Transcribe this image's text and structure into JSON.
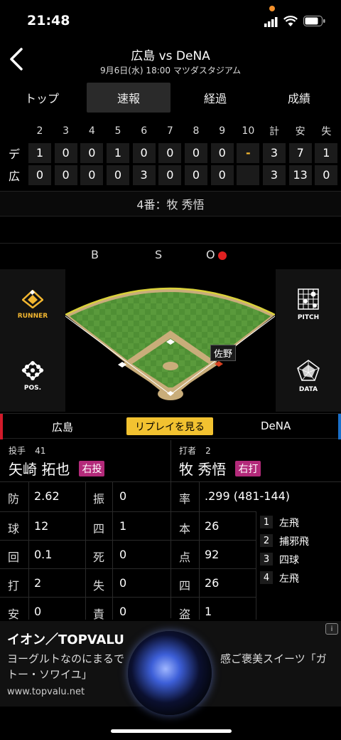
{
  "status": {
    "time": "21:48"
  },
  "header": {
    "title": "広島 vs DeNA",
    "subtitle": "9月6日(水) 18:00 マツダスタジアム"
  },
  "tabs": [
    "トップ",
    "速報",
    "経過",
    "成績"
  ],
  "active_tab": "速報",
  "scoreboard": {
    "headers": [
      "2",
      "3",
      "4",
      "5",
      "6",
      "7",
      "8",
      "9",
      "10",
      "計",
      "安",
      "失"
    ],
    "rows": [
      {
        "team": "デ",
        "cells": [
          "1",
          "0",
          "0",
          "1",
          "0",
          "0",
          "0",
          "0",
          "-",
          "3",
          "7",
          "1"
        ]
      },
      {
        "team": "広",
        "cells": [
          "0",
          "0",
          "0",
          "0",
          "3",
          "0",
          "0",
          "0",
          "",
          "3",
          "13",
          "0"
        ]
      }
    ]
  },
  "batter_line": "4番：牧 秀悟",
  "bso": {
    "b": "B",
    "s": "S",
    "o": "O"
  },
  "side_buttons": {
    "runner": "RUNNER",
    "pos": "POS.",
    "pitch": "PITCH",
    "data": "DATA"
  },
  "field": {
    "runner_label": "佐野"
  },
  "team_bar": {
    "home": "広島",
    "away": "DeNA",
    "replay": "リプレイを見る"
  },
  "pitcher": {
    "role": "投手",
    "number": "41",
    "name": "矢崎 拓也",
    "hand": "右投"
  },
  "batter": {
    "role": "打者",
    "number": "2",
    "name": "牧 秀悟",
    "hand": "右打"
  },
  "pitcher_stats": [
    {
      "l1": "防",
      "v1": "2.62",
      "l2": "振",
      "v2": "0"
    },
    {
      "l1": "球",
      "v1": "12",
      "l2": "四",
      "v2": "1"
    },
    {
      "l1": "回",
      "v1": "0.1",
      "l2": "死",
      "v2": "0"
    },
    {
      "l1": "打",
      "v1": "2",
      "l2": "失",
      "v2": "0"
    },
    {
      "l1": "安",
      "v1": "0",
      "l2": "責",
      "v2": "0"
    }
  ],
  "batter_stats": [
    {
      "l": "率",
      "v": ".299 (481-144)"
    },
    {
      "l": "本",
      "v": "26"
    },
    {
      "l": "点",
      "v": "92"
    },
    {
      "l": "四",
      "v": "26"
    },
    {
      "l": "盗",
      "v": "1"
    }
  ],
  "at_bats": [
    {
      "n": "1",
      "r": "左飛"
    },
    {
      "n": "2",
      "r": "捕邪飛"
    },
    {
      "n": "3",
      "r": "四球"
    },
    {
      "n": "4",
      "r": "左飛"
    }
  ],
  "ad": {
    "title": "イオン／TOPVALU",
    "text": "ヨーグルトなのにまるで　　　　　　　　　感ご褒美スイーツ「ガトー・ソワイユ」",
    "url": "www.topvalu.net",
    "badge": "i"
  }
}
